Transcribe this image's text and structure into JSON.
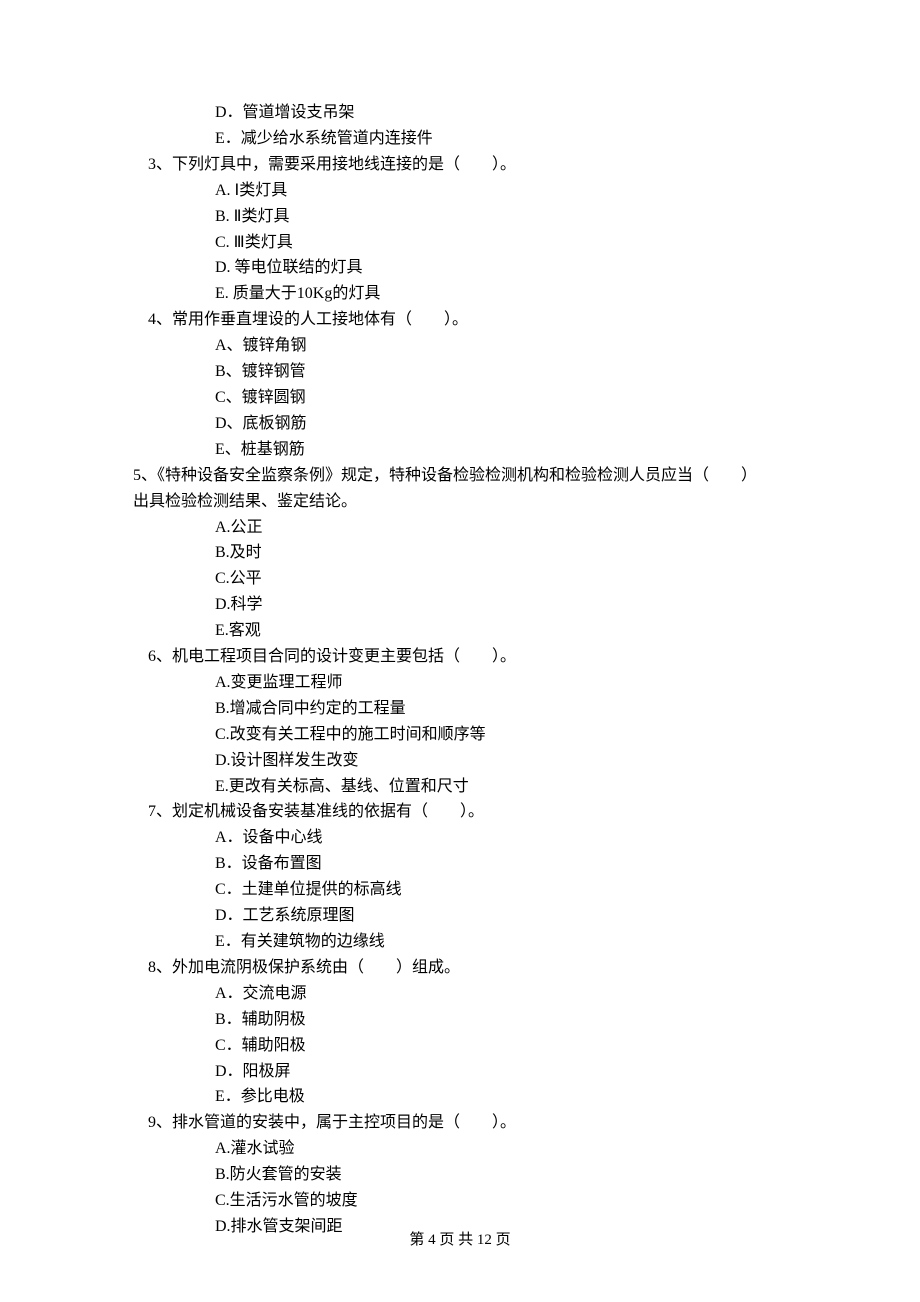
{
  "pre_options": {
    "d": "D．管道增设支吊架",
    "e": "E．减少给水系统管道内连接件"
  },
  "q3": {
    "stem": "3、下列灯具中，需要采用接地线连接的是（　　）。",
    "a": "A.  Ⅰ类灯具",
    "b": "B.  Ⅱ类灯具",
    "c": "C.  Ⅲ类灯具",
    "d": "D.  等电位联结的灯具",
    "e": "E.  质量大于10Kg的灯具"
  },
  "q4": {
    "stem": "4、常用作垂直埋设的人工接地体有（　　）。",
    "a": "A、镀锌角钢",
    "b": "B、镀锌钢管",
    "c": "C、镀锌圆钢",
    "d": "D、底板钢筋",
    "e": "E、桩基钢筋"
  },
  "q5": {
    "stem": "5、《特种设备安全监察条例》规定，特种设备检验检测机构和检验检测人员应当（　　）出具检验检测结果、鉴定结论。",
    "a": "A.公正",
    "b": "B.及时",
    "c": "C.公平",
    "d": "D.科学",
    "e": "E.客观"
  },
  "q6": {
    "stem": "6、机电工程项目合同的设计变更主要包括（　　）。",
    "a": "A.变更监理工程师",
    "b": "B.增减合同中约定的工程量",
    "c": "C.改变有关工程中的施工时间和顺序等",
    "d": "D.设计图样发生改变",
    "e": "E.更改有关标高、基线、位置和尺寸"
  },
  "q7": {
    "stem": "7、划定机械设备安装基准线的依据有（　　）。",
    "a": "A．设备中心线",
    "b": "B．设备布置图",
    "c": "C．土建单位提供的标高线",
    "d": "D．工艺系统原理图",
    "e": "E．有关建筑物的边缘线"
  },
  "q8": {
    "stem": "8、外加电流阴极保护系统由（　　）组成。",
    "a": "A．交流电源",
    "b": "B．辅助阴极",
    "c": "C．辅助阳极",
    "d": "D．阳极屏",
    "e": "E．参比电极"
  },
  "q9": {
    "stem": "9、排水管道的安装中，属于主控项目的是（　　）。",
    "a": "A.灌水试验",
    "b": "B.防火套管的安装",
    "c": "C.生活污水管的坡度",
    "d": "D.排水管支架间距"
  },
  "footer": "第 4 页 共 12 页"
}
